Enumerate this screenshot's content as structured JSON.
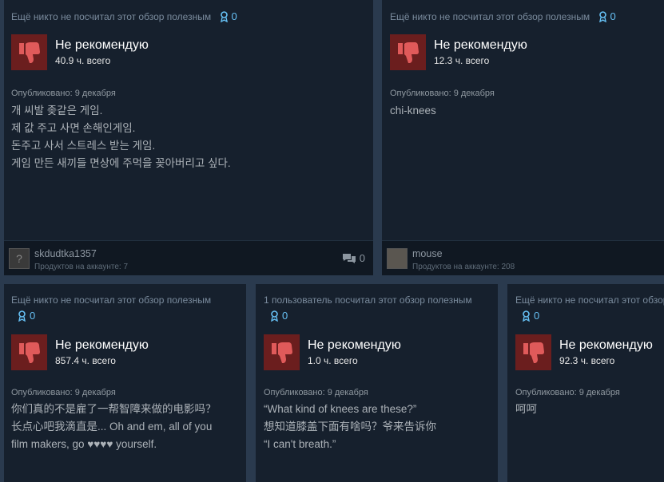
{
  "colors": {
    "background": "#2a3a4e",
    "card": "#16202d",
    "thumb_bg": "#6b1e1e",
    "thumb_icon": "#e05a5a",
    "award": "#66c0f4"
  },
  "reviews": [
    {
      "helpful_text": "Ещё никто не посчитал этот обзор полезным",
      "award_count": "0",
      "verdict": "Не рекомендую",
      "hours": "40.9 ч. всего",
      "posted": "Опубликовано: 9 декабря",
      "lines": [
        "개 씨발 좆같은 게임.",
        "제 값 주고 사면 손해인게임.",
        "돈주고 사서 스트레스 받는 게임.",
        "게임 만든 새끼들 면상에 주먹을 꽂아버리고 싶다."
      ],
      "author": "skdudtka1357",
      "products": "Продуктов на аккаунте: 7",
      "comments": "0",
      "avatar_icon": "question-mark-icon"
    },
    {
      "helpful_text": "Ещё никто не посчитал этот обзор полезным",
      "award_count": "0",
      "verdict": "Не рекомендую",
      "hours": "12.3 ч. всего",
      "posted": "Опубликовано: 9 декабря",
      "lines": [
        "chi-knees"
      ],
      "author": "mouse",
      "products": "Продуктов на аккаунте: 208"
    },
    {
      "helpful_text": "Ещё никто не посчитал этот обзор полезным",
      "award_count": "0",
      "verdict": "Не рекомендую",
      "hours": "857.4 ч. всего",
      "posted": "Опубликовано: 9 декабря",
      "lines": [
        "你们真的不是雇了一帮智障来做的电影吗？",
        "长点心吧我滴直是... Oh and em, all of you",
        "film makers, go ♥♥♥♥ yourself."
      ]
    },
    {
      "helpful_text": "1 пользователь посчитал этот обзор полезным",
      "award_count": "0",
      "verdict": "Не рекомендую",
      "hours": "1.0 ч. всего",
      "posted": "Опубликовано: 9 декабря",
      "lines": [
        "“What kind of knees are these?”",
        "想知道膝盖下面有啥吗？爷来告诉你",
        "“I can't breath.”"
      ]
    },
    {
      "helpful_text": "Ещё никто не посчитал этот обзор полезным",
      "award_count": "0",
      "verdict": "Не рекомендую",
      "hours": "92.3 ч. всего",
      "posted": "Опубликовано: 9 декабря",
      "lines": [
        "呵呵"
      ]
    }
  ]
}
